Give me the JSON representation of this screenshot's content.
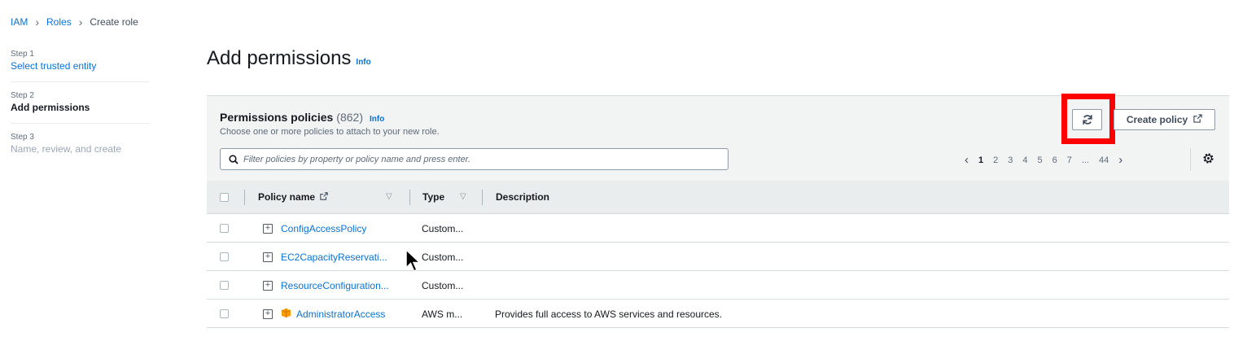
{
  "breadcrumb": {
    "items": [
      "IAM",
      "Roles"
    ],
    "current": "Create role"
  },
  "steps": [
    {
      "num": "Step 1",
      "label": "Select trusted entity"
    },
    {
      "num": "Step 2",
      "label": "Add permissions"
    },
    {
      "num": "Step 3",
      "label": "Name, review, and create"
    }
  ],
  "page": {
    "title": "Add permissions",
    "info": "Info"
  },
  "panel": {
    "title": "Permissions policies",
    "count": "(862)",
    "info": "Info",
    "description": "Choose one or more policies to attach to your new role.",
    "create_policy": "Create policy",
    "search_placeholder": "Filter policies by property or policy name and press enter."
  },
  "pager": {
    "pages": [
      "1",
      "2",
      "3",
      "4",
      "5",
      "6",
      "7",
      "...",
      "44"
    ],
    "current": "1"
  },
  "table": {
    "columns": {
      "name": "Policy name",
      "type": "Type",
      "description": "Description"
    },
    "rows": [
      {
        "name": "ConfigAccessPolicy",
        "type": "Custom...",
        "description": ""
      },
      {
        "name": "EC2CapacityReservati...",
        "type": "Custom...",
        "description": ""
      },
      {
        "name": "ResourceConfiguration...",
        "type": "Custom...",
        "description": ""
      },
      {
        "name": "AdministratorAccess",
        "type": "AWS m...",
        "description": "Provides full access to AWS services and resources."
      }
    ]
  },
  "icons": {
    "breadcrumb_sep": "chevron-right-icon",
    "refresh": "refresh-icon",
    "external": "external-link-icon",
    "search": "search-icon",
    "settings": "gear-icon",
    "expand": "expand-plus-icon",
    "aws_managed": "aws-managed-icon"
  },
  "colors": {
    "link": "#0972d3",
    "highlight": "#ff0000",
    "header_bg": "#f2f3f3",
    "aws_orange": "#f90"
  }
}
